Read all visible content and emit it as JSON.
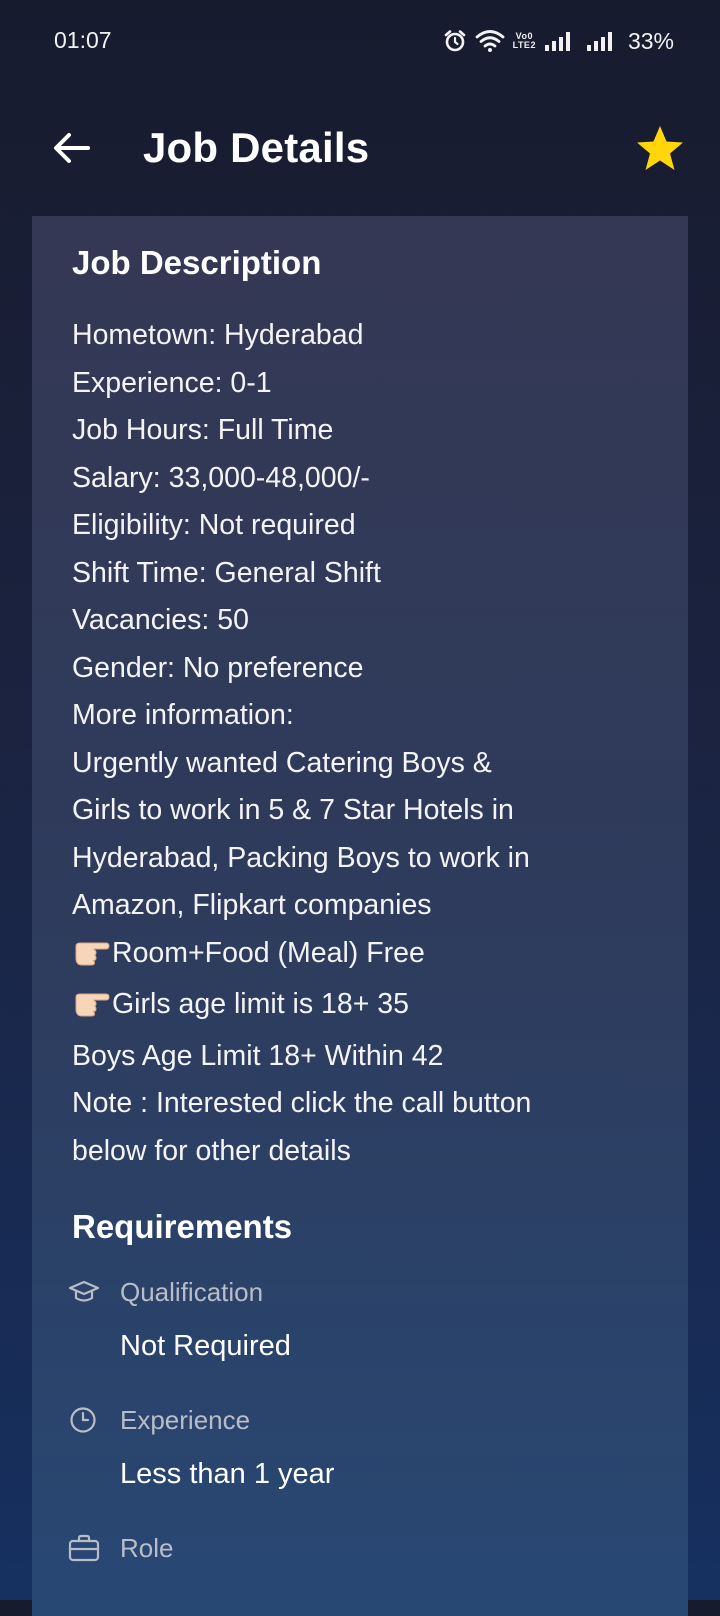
{
  "status_bar": {
    "time": "01:07",
    "volte_top": "Vo0",
    "volte_bottom": "LTE2",
    "battery": "33%"
  },
  "app_bar": {
    "title": "Job Details",
    "back_icon": "arrow-left-icon",
    "favorite_icon": "star-icon",
    "favorite_color": "#FFD60A"
  },
  "job_description": {
    "title": "Job Description",
    "lines": [
      "Hometown: Hyderabad",
      "Experience: 0-1",
      "Job Hours: Full Time",
      "Salary: 33,000-48,000/-",
      "Eligibility: Not required",
      "Shift Time: General Shift",
      "Vacancies: 50",
      "Gender: No preference",
      "More information:",
      "Urgently wanted Catering Boys &",
      "Girls to work in 5 & 7 Star Hotels in",
      "Hyderabad, Packing Boys to work in",
      "Amazon, Flipkart companies",
      "Room+Food (Meal) Free",
      "Girls age limit is 18+ 35",
      "Boys Age Limit 18+ Within 42",
      "Note : Interested click the call button",
      "below for other details"
    ]
  },
  "requirements": {
    "title": "Requirements",
    "items": [
      {
        "label": "Qualification",
        "value": "Not Required",
        "icon": "graduation-cap-icon"
      },
      {
        "label": "Experience",
        "value": "Less than 1 year",
        "icon": "clock-icon"
      },
      {
        "label": "Role",
        "value": "",
        "icon": "briefcase-icon"
      }
    ]
  }
}
